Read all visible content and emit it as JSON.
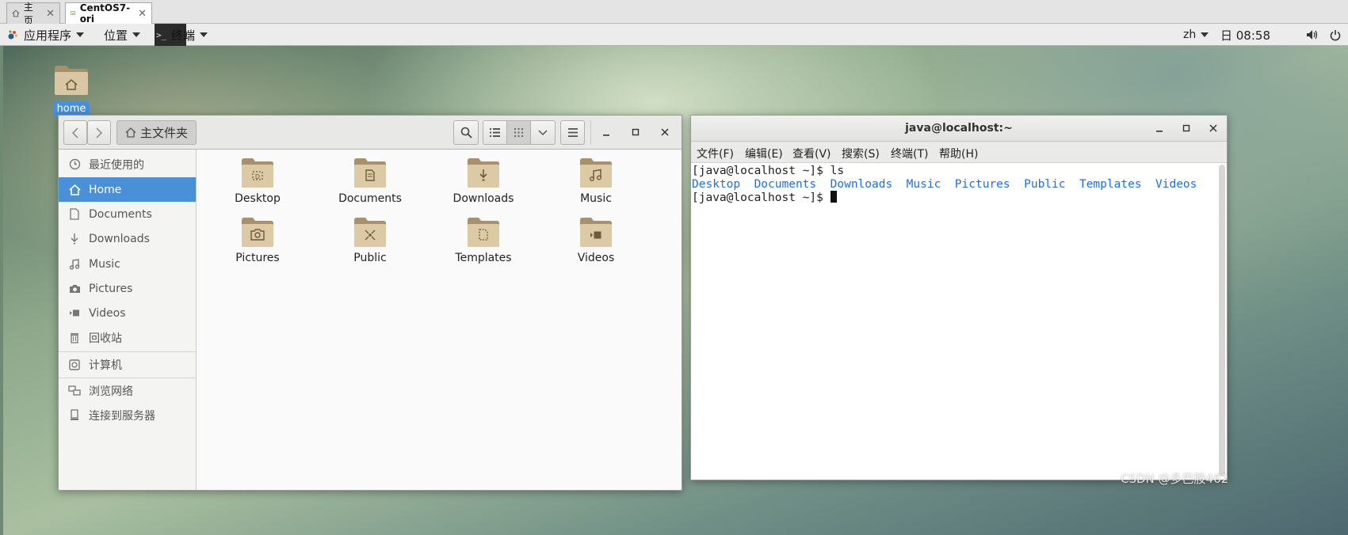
{
  "vm_tabs": [
    {
      "label": "主页",
      "icon": "home-icon"
    },
    {
      "label": "CentOS7-ori",
      "icon": "vm-icon"
    }
  ],
  "topbar": {
    "apps_label": "应用程序",
    "places_label": "位置",
    "terminal_label": "终端",
    "lang": "zh",
    "clock": "日 08:58",
    "icons": [
      "volume-icon",
      "power-icon"
    ]
  },
  "desktop": {
    "home_icon_label": "home"
  },
  "files_window": {
    "path_label": "主文件夹",
    "sidebar": [
      {
        "label": "最近使用的",
        "icon": "clock-icon"
      },
      {
        "label": "Home",
        "icon": "home-icon",
        "active": true
      },
      {
        "label": "Documents",
        "icon": "document-icon"
      },
      {
        "label": "Downloads",
        "icon": "download-icon"
      },
      {
        "label": "Music",
        "icon": "music-icon"
      },
      {
        "label": "Pictures",
        "icon": "camera-icon"
      },
      {
        "label": "Videos",
        "icon": "video-icon"
      },
      {
        "label": "回收站",
        "icon": "trash-icon"
      },
      {
        "label": "计算机",
        "icon": "computer-icon"
      },
      {
        "label": "浏览网络",
        "icon": "network-icon"
      },
      {
        "label": "连接到服务器",
        "icon": "server-icon"
      }
    ],
    "folders": [
      {
        "label": "Desktop",
        "emblem": "desktop"
      },
      {
        "label": "Documents",
        "emblem": "document"
      },
      {
        "label": "Downloads",
        "emblem": "download"
      },
      {
        "label": "Music",
        "emblem": "music"
      },
      {
        "label": "Pictures",
        "emblem": "camera"
      },
      {
        "label": "Public",
        "emblem": "share"
      },
      {
        "label": "Templates",
        "emblem": "template"
      },
      {
        "label": "Videos",
        "emblem": "video"
      }
    ]
  },
  "terminal": {
    "title": "java@localhost:~",
    "menu": [
      "文件(F)",
      "编辑(E)",
      "查看(V)",
      "搜索(S)",
      "终端(T)",
      "帮助(H)"
    ],
    "lines": [
      {
        "prompt": "[java@localhost ~]$ ",
        "cmd": "ls"
      },
      {
        "dirs": [
          "Desktop",
          "Documents",
          "Downloads",
          "Music",
          "Pictures",
          "Public",
          "Templates",
          "Videos"
        ]
      },
      {
        "prompt": "[java@localhost ~]$ ",
        "cmd": ""
      }
    ]
  },
  "watermark": "CSDN @多巴胺462"
}
